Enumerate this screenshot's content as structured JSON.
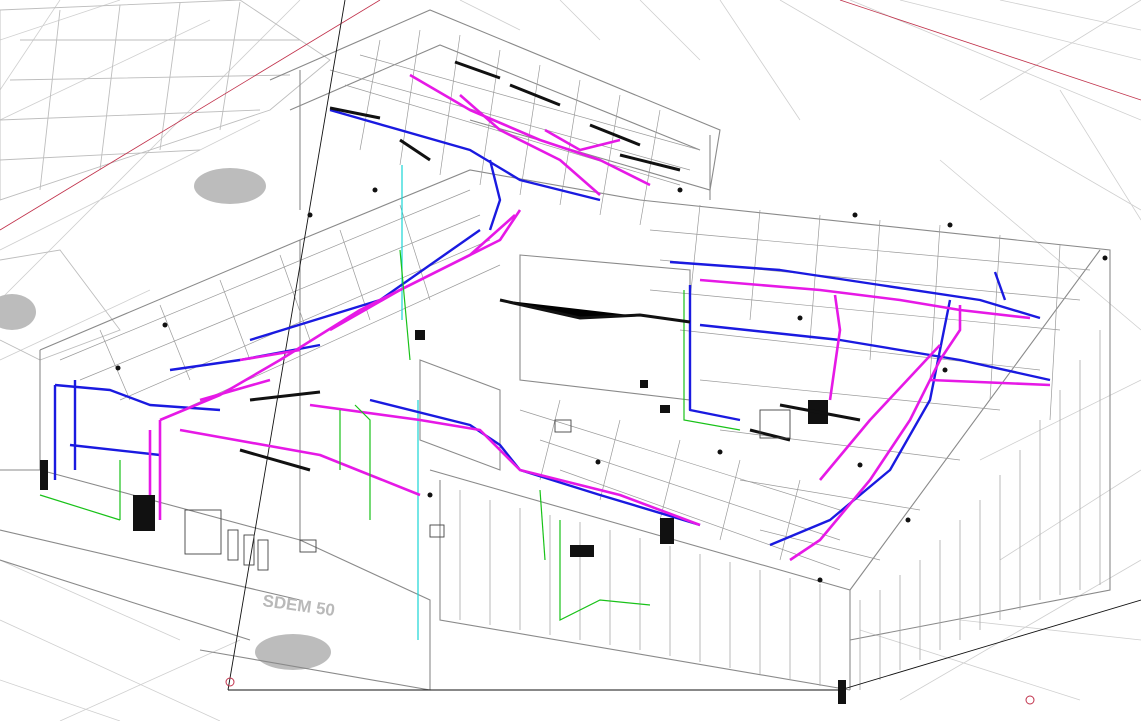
{
  "view": {
    "building_label": "SDEM 50"
  },
  "colors": {
    "background": "#ffffff",
    "context_lines": "#c8c8c8",
    "building_lines": "#8a8a8a",
    "supply_duct": "#e619e6",
    "return_duct": "#1a1ae0",
    "piping": "#19c219",
    "vertical_pipe": "#19d6d6",
    "section_line": "#c0304a",
    "equipment": "#111111"
  }
}
